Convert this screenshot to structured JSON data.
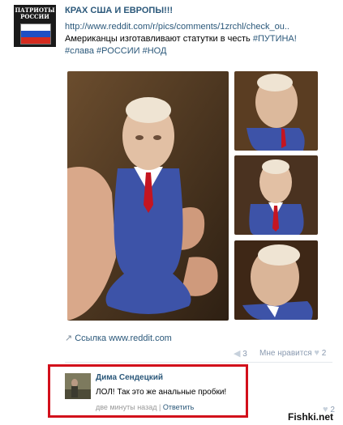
{
  "post": {
    "group_logo_text": [
      "ПАТРИОТЫ",
      "РОССИИ"
    ],
    "title": "КРАХ США И ЕВРОПЫ!!!",
    "link": "http://www.reddit.com/r/pics/comments/1zrchl/check_ou..",
    "line2": "Американцы изготавливают статутки в честь",
    "hashtag_putin": "#ПУТИНА!",
    "hashtags_line": "#слава #РОССИИ #НОД",
    "attachment_link": "Ссылка www.reddit.com",
    "reposts": "3",
    "likes_label": "Мне нравится",
    "likes": "2",
    "colors": {
      "link": "#2b587a",
      "highlight_border": "#d2101b"
    }
  },
  "comment": {
    "author": "Дима Сендецкий",
    "text": "ЛОЛ! Так это же анальные пробки!",
    "time": "две минуты назад",
    "separator": "|",
    "reply_label": "Ответить",
    "likes": "2"
  },
  "watermark": "Fishki.net"
}
